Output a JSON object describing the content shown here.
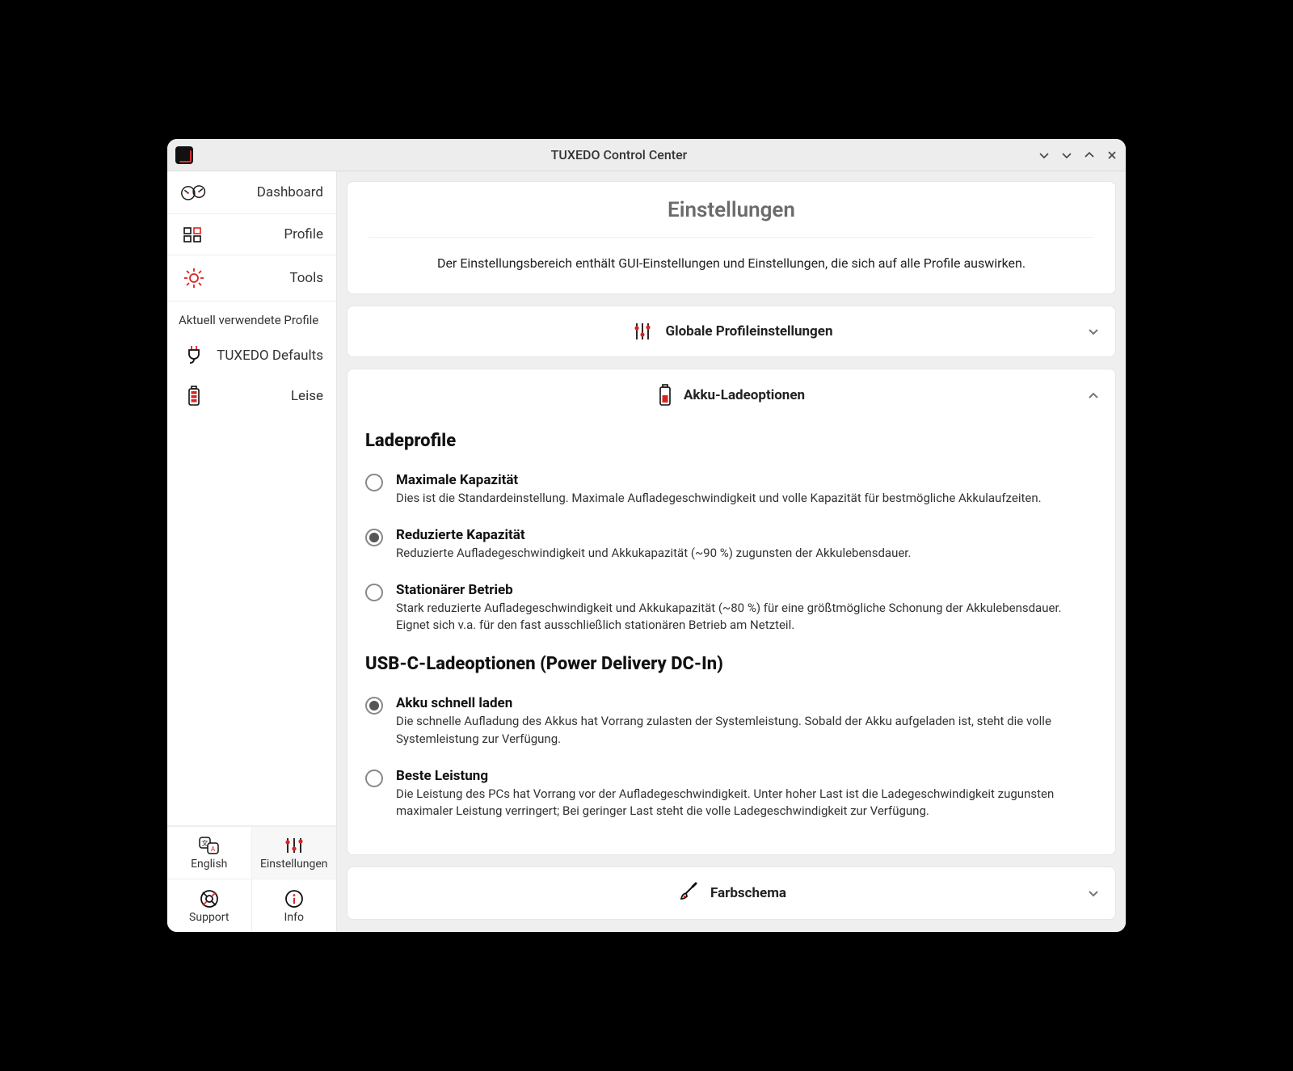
{
  "window": {
    "title": "TUXEDO Control Center"
  },
  "sidebar": {
    "nav": [
      {
        "label": "Dashboard"
      },
      {
        "label": "Profile"
      },
      {
        "label": "Tools"
      }
    ],
    "section_label": "Aktuell verwendete Profile",
    "profiles": [
      {
        "label": "TUXEDO Defaults"
      },
      {
        "label": "Leise"
      }
    ],
    "bottom": {
      "language": "English",
      "settings": "Einstellungen",
      "support": "Support",
      "info": "Info"
    }
  },
  "content": {
    "intro": {
      "title": "Einstellungen",
      "description": "Der Einstellungsbereich enthält GUI-Einstellungen und Einstellungen, die sich auf alle Profile auswirken."
    },
    "panels": {
      "global": {
        "label": "Globale Profileinstellungen"
      },
      "battery": {
        "label": "Akku-Ladeoptionen",
        "section1_title": "Ladeprofile",
        "opts1": [
          {
            "title": "Maximale Kapazität",
            "desc": "Dies ist die Standardeinstellung. Maximale Aufladegeschwindigkeit und volle Kapazität für bestmögliche Akkulaufzeiten.",
            "selected": false
          },
          {
            "title": "Reduzierte Kapazität",
            "desc": "Reduzierte Aufladegeschwindigkeit und Akkukapazität (~90 %) zugunsten der Akkulebensdauer.",
            "selected": true
          },
          {
            "title": "Stationärer Betrieb",
            "desc": "Stark reduzierte Aufladegeschwindigkeit und Akkukapazität (~80 %) für eine größtmögliche Schonung der Akkulebensdauer. Eignet sich v.a. für den fast ausschließlich stationären Betrieb am Netzteil.",
            "selected": false
          }
        ],
        "section2_title": "USB-C-Ladeoptionen (Power Delivery DC-In)",
        "opts2": [
          {
            "title": "Akku schnell laden",
            "desc": "Die schnelle Aufladung des Akkus hat Vorrang zulasten der Systemleistung. Sobald der Akku aufgeladen ist, steht die volle Systemleistung zur Verfügung.",
            "selected": true
          },
          {
            "title": "Beste Leistung",
            "desc": "Die Leistung des PCs hat Vorrang vor der Aufladegeschwindigkeit. Unter hoher Last ist die Ladegeschwindigkeit zugunsten maximaler Leistung verringert; Bei geringer Last steht die volle Ladegeschwindigkeit zur Verfügung.",
            "selected": false
          }
        ]
      },
      "theme": {
        "label": "Farbschema"
      }
    }
  }
}
